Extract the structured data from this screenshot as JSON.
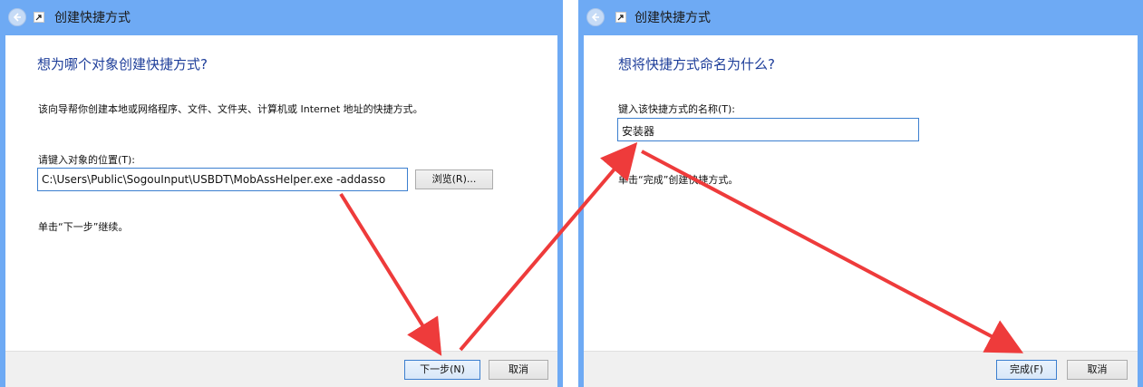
{
  "colors": {
    "window_frame": "#6eaaf4",
    "heading": "#1e3e9a",
    "arrow": "#ee3b3b",
    "focus_border": "#3c7fcf"
  },
  "icons": {
    "back": "back-arrow-icon",
    "shortcut": "shortcut-icon"
  },
  "window1": {
    "title": "创建快捷方式",
    "heading": "想为哪个对象创建快捷方式?",
    "description": "该向导帮你创建本地或网络程序、文件、文件夹、计算机或 Internet 地址的快捷方式。",
    "location_label": "请键入对象的位置(T):",
    "location_value": "C:\\Users\\Public\\SogouInput\\USBDT\\MobAssHelper.exe -addasso",
    "browse_button": "浏览(R)...",
    "hint": "单击“下一步”继续。",
    "next_button": "下一步(N)",
    "cancel_button": "取消"
  },
  "window2": {
    "title": "创建快捷方式",
    "heading": "想将快捷方式命名为什么?",
    "name_label": "键入该快捷方式的名称(T):",
    "name_value": "安装器",
    "hint": "单击“完成”创建快捷方式。",
    "finish_button": "完成(F)",
    "cancel_button": "取消"
  }
}
